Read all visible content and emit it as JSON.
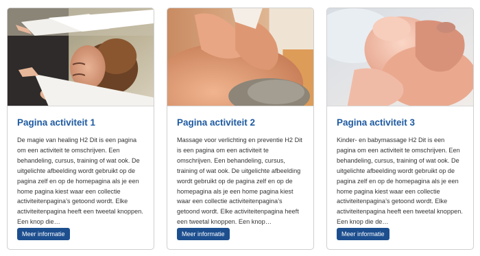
{
  "cards": [
    {
      "title": "Pagina activiteit 1",
      "text": "De magie van healing H2 Dit is een pagina om een activiteit te omschrijven. Een behandeling, cursus, training of wat ook. De uitgelichte afbeelding wordt gebruikt op de pagina zelf en op de homepagina als je een home pagina kiest waar een collectie activiteitenpagina’s getoond wordt. Elke activiteitenpagina heeft een tweetal knoppen. Een knop die…",
      "button_label": "Meer informatie",
      "image": "healing-hands-photo"
    },
    {
      "title": "Pagina activiteit 2",
      "text": "Massage voor verlichting en preventie H2 Dit is een pagina om een activiteit te omschrijven. Een behandeling, cursus, training of wat ook. De uitgelichte afbeelding wordt gebruikt op de pagina zelf en op de homepagina als je een home pagina kiest waar een collectie activiteitenpagina’s getoond wordt. Elke activiteitenpagina heeft een tweetal knoppen. Een knop…",
      "button_label": "Meer informatie",
      "image": "shoulder-massage-photo"
    },
    {
      "title": "Pagina activiteit 3",
      "text": "Kinder- en babymassage H2 Dit is een pagina om een activiteit te omschrijven. Een behandeling, cursus, training of wat ook. De uitgelichte afbeelding wordt gebruikt op de pagina zelf en op de homepagina als je een home pagina kiest waar een collectie activiteitenpagina’s getoond wordt. Elke activiteitenpagina heeft een tweetal knoppen. Een knop die de…",
      "button_label": "Meer informatie",
      "image": "baby-foot-massage-photo"
    }
  ],
  "colors": {
    "title": "#1e5aa1",
    "button": "#1d4f8f",
    "text": "#333333",
    "border": "#cfcfcf"
  }
}
